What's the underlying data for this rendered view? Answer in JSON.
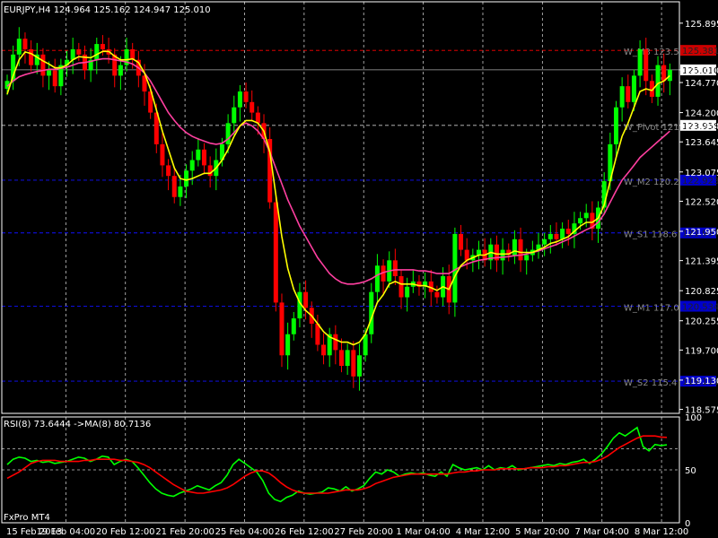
{
  "window": {
    "symbol_line": "EURJPY,H4  124.964 125.162 124.947 125.010",
    "indicator_line": "RSI(8) 73.6444  ->MA(8) 80.7136",
    "broker_label": "FxPro MT4"
  },
  "colors": {
    "background": "#000000",
    "bull": "#00ff00",
    "bear": "#ff0000",
    "ma_fast": "#ffff00",
    "ma_slow": "#ff3fa0",
    "rsi": "#00ff00",
    "rsi_ma": "#ff0000",
    "level_red": "#ff0000",
    "level_blue": "#1010ff",
    "grid": "#c8c8c8",
    "axis_text": "#ffffff"
  },
  "chart_data": [
    {
      "type": "candlestick",
      "title": "EURJPY,H4",
      "ylim": [
        118.5,
        126.3
      ],
      "y_ticks": [
        "125.895",
        "125.010",
        "124.770",
        "124.200",
        "123.958",
        "123.645",
        "123.075",
        "122.520",
        "121.950",
        "121.395",
        "120.825",
        "120.255",
        "119.700",
        "119.130",
        "118.575"
      ],
      "x_ticks": [
        "15 Feb 2013",
        "19 Feb 04:00",
        "20 Feb 12:00",
        "21 Feb 20:00",
        "25 Feb 04:00",
        "26 Feb 12:00",
        "27 Feb 20:00",
        "1 Mar 04:00",
        "4 Mar 12:00",
        "5 Mar 20:00",
        "7 Mar 04:00",
        "8 Mar 12:00"
      ],
      "current_price": 125.01,
      "levels": [
        {
          "name": "W_M3",
          "label": "W_M3 123.5",
          "price": 125.38,
          "color": "red",
          "price_label": "125.381"
        },
        {
          "name": "W_Pivot",
          "label": "W_Pivot 121",
          "price": 123.958,
          "color": "white",
          "price_label": "123.958"
        },
        {
          "name": "W_M2",
          "label": "W_M2 120.2",
          "price": 122.92,
          "color": "blue",
          "price_label": "122.923"
        },
        {
          "name": "W_S1",
          "label": "W_S1 118.6",
          "price": 121.92,
          "color": "blue",
          "price_label": "121.937"
        },
        {
          "name": "W_M1",
          "label": "W_M1 117.0",
          "price": 120.53,
          "color": "blue",
          "price_label": "120.534"
        },
        {
          "name": "W_S2",
          "label": "W_S2 115.4",
          "price": 119.11,
          "color": "blue",
          "price_label": "119.111"
        }
      ],
      "candles_close": [
        124.8,
        125.3,
        125.6,
        125.4,
        125.1,
        125.3,
        124.9,
        125.0,
        124.7,
        125.1,
        125.2,
        125.4,
        125.3,
        125.0,
        125.2,
        125.5,
        125.4,
        125.3,
        124.9,
        125.1,
        125.4,
        125.2,
        124.9,
        124.6,
        124.2,
        123.6,
        123.2,
        123.0,
        122.6,
        122.8,
        123.1,
        123.3,
        123.5,
        123.2,
        123.0,
        123.3,
        123.6,
        124.0,
        124.3,
        124.6,
        124.4,
        124.2,
        124.0,
        123.7,
        122.5,
        120.6,
        119.6,
        120.0,
        120.3,
        120.8,
        120.5,
        120.2,
        119.8,
        119.6,
        120.0,
        119.7,
        119.4,
        119.7,
        119.2,
        119.6,
        120.0,
        120.8,
        121.3,
        121.0,
        121.4,
        121.1,
        120.7,
        120.9,
        121.0,
        120.9,
        121.0,
        120.8,
        120.7,
        121.1,
        120.6,
        121.9,
        121.6,
        121.4,
        121.5,
        121.6,
        121.4,
        121.7,
        121.4,
        121.6,
        121.5,
        121.8,
        121.4,
        121.5,
        121.6,
        121.7,
        121.8,
        121.9,
        121.8,
        122.0,
        121.9,
        122.1,
        122.2,
        122.3,
        122.0,
        122.4,
        122.9,
        123.6,
        124.3,
        124.7,
        124.4,
        124.9,
        125.4,
        124.8,
        124.5,
        125.1,
        124.8,
        125.01
      ],
      "ma_fast": [
        124.55,
        124.9,
        125.2,
        125.35,
        125.32,
        125.25,
        125.18,
        125.12,
        125.05,
        125.05,
        125.1,
        125.2,
        125.26,
        125.25,
        125.24,
        125.3,
        125.36,
        125.36,
        125.27,
        125.2,
        125.2,
        125.22,
        125.15,
        124.95,
        124.65,
        124.25,
        123.85,
        123.5,
        123.15,
        122.95,
        122.92,
        122.95,
        123.0,
        123.05,
        123.05,
        123.15,
        123.3,
        123.5,
        123.75,
        123.95,
        124.05,
        124.05,
        124.0,
        123.85,
        123.45,
        122.65,
        121.85,
        121.25,
        120.85,
        120.6,
        120.45,
        120.35,
        120.2,
        120.05,
        119.95,
        119.9,
        119.85,
        119.85,
        119.8,
        119.85,
        120.0,
        120.3,
        120.6,
        120.75,
        120.95,
        121.0,
        120.95,
        120.95,
        120.95,
        120.92,
        120.92,
        120.88,
        120.83,
        120.9,
        120.85,
        121.1,
        121.3,
        121.4,
        121.45,
        121.5,
        121.5,
        121.55,
        121.52,
        121.52,
        121.52,
        121.58,
        121.55,
        121.55,
        121.55,
        121.6,
        121.65,
        121.72,
        121.75,
        121.8,
        121.85,
        121.95,
        122.05,
        122.12,
        122.12,
        122.2,
        122.45,
        122.9,
        123.35,
        123.75,
        124.0,
        124.3,
        124.6,
        124.65,
        124.62,
        124.75,
        124.8,
        124.9
      ],
      "ma_slow": [
        124.7,
        124.8,
        124.88,
        124.92,
        124.95,
        124.98,
        125.0,
        125.02,
        125.02,
        125.04,
        125.06,
        125.1,
        125.14,
        125.15,
        125.17,
        125.2,
        125.22,
        125.22,
        125.2,
        125.18,
        125.16,
        125.12,
        125.05,
        124.95,
        124.8,
        124.6,
        124.4,
        124.2,
        124.05,
        123.92,
        123.82,
        123.75,
        123.7,
        123.66,
        123.62,
        123.6,
        123.62,
        123.7,
        123.82,
        123.95,
        124.0,
        123.95,
        123.85,
        123.7,
        123.45,
        123.15,
        122.85,
        122.55,
        122.3,
        122.05,
        121.85,
        121.65,
        121.45,
        121.3,
        121.15,
        121.05,
        120.98,
        120.95,
        120.95,
        120.97,
        121.0,
        121.05,
        121.12,
        121.17,
        121.2,
        121.22,
        121.22,
        121.22,
        121.22,
        121.2,
        121.2,
        121.18,
        121.15,
        121.15,
        121.15,
        121.22,
        121.28,
        121.33,
        121.37,
        121.4,
        121.42,
        121.44,
        121.45,
        121.46,
        121.47,
        121.49,
        121.5,
        121.52,
        121.55,
        121.58,
        121.62,
        121.66,
        121.7,
        121.75,
        121.8,
        121.86,
        121.92,
        121.98,
        122.03,
        122.12,
        122.28,
        122.5,
        122.72,
        122.92,
        123.06,
        123.2,
        123.35,
        123.45,
        123.55,
        123.65,
        123.75,
        123.85
      ]
    },
    {
      "type": "line",
      "title": "RSI(8)",
      "ylim": [
        0,
        100
      ],
      "y_ticks": [
        "100",
        "50",
        "0"
      ],
      "levels": [
        70,
        50
      ],
      "series": [
        {
          "name": "RSI(8)",
          "values": [
            55,
            60,
            62,
            61,
            58,
            59,
            57,
            58,
            56,
            57,
            58,
            60,
            62,
            61,
            58,
            60,
            63,
            62,
            55,
            58,
            60,
            58,
            52,
            45,
            38,
            32,
            28,
            26,
            25,
            28,
            30,
            32,
            35,
            33,
            31,
            35,
            38,
            45,
            55,
            60,
            56,
            52,
            48,
            40,
            28,
            22,
            20,
            24,
            26,
            30,
            28,
            27,
            28,
            29,
            33,
            32,
            30,
            34,
            30,
            32,
            35,
            42,
            48,
            46,
            50,
            48,
            44,
            46,
            47,
            46,
            47,
            45,
            44,
            48,
            44,
            55,
            52,
            50,
            51,
            52,
            50,
            54,
            50,
            52,
            51,
            54,
            50,
            51,
            52,
            53,
            54,
            55,
            54,
            56,
            55,
            57,
            58,
            60,
            56,
            60,
            65,
            72,
            80,
            85,
            82,
            86,
            90,
            72,
            68,
            74,
            73,
            73.6444
          ]
        },
        {
          "name": "->MA(8)",
          "values": [
            42,
            45,
            48,
            52,
            56,
            58,
            59,
            59,
            59,
            58,
            58,
            58,
            58,
            59,
            59,
            60,
            60,
            60,
            60,
            59,
            59,
            58,
            57,
            55,
            52,
            48,
            44,
            40,
            36,
            33,
            30,
            29,
            28,
            28,
            29,
            30,
            31,
            33,
            36,
            40,
            44,
            47,
            49,
            49,
            47,
            43,
            38,
            34,
            31,
            29,
            28,
            28,
            28,
            28,
            28,
            29,
            30,
            31,
            31,
            31,
            32,
            34,
            37,
            39,
            41,
            43,
            44,
            45,
            46,
            46,
            46,
            46,
            46,
            46,
            46,
            47,
            48,
            48,
            49,
            49,
            50,
            50,
            50,
            51,
            51,
            51,
            51,
            51,
            52,
            52,
            52,
            53,
            53,
            54,
            54,
            55,
            56,
            57,
            57,
            58,
            60,
            63,
            67,
            71,
            74,
            77,
            80,
            82,
            82,
            82,
            81,
            80.7136
          ]
        }
      ]
    }
  ]
}
